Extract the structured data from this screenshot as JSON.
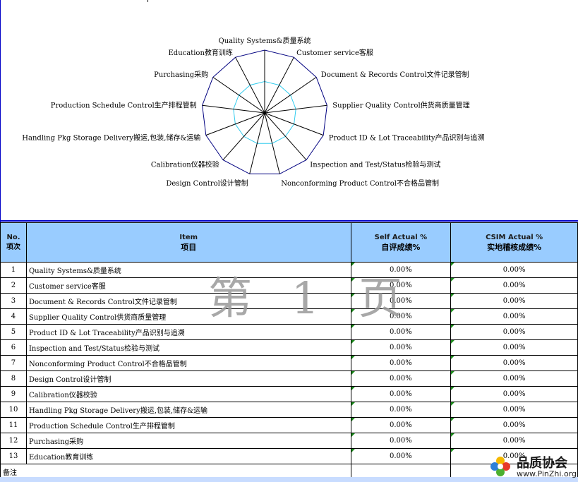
{
  "chart_data": {
    "type": "radar",
    "title": "",
    "categories": [
      "Quality Systems&质量系统",
      "Customer service客服",
      "Document & Records Control文件记录管制",
      "Supplier Quality Control供货商质量管理",
      "Product ID & Lot Traceability产品识别与追溯",
      "Inspection and Test/Status检验与测试",
      "Nonconforming Product Control不合格品管制",
      "Design Control设计管制",
      "Calibration仪器校验",
      "Handling Pkg Storage Delivery搬运,包装,储存&运输",
      "Production Schedule Control生产排程管制",
      "Purchasing采购",
      "Education教育训练"
    ],
    "series": [
      {
        "values": [
          0,
          0,
          0,
          0,
          0,
          0,
          0,
          0,
          0,
          0,
          0,
          0,
          0
        ],
        "color": "#000000"
      },
      {
        "values": [
          0,
          0,
          0,
          0,
          0,
          0,
          0,
          0,
          0,
          0,
          0,
          0,
          0
        ],
        "color": "#000000"
      }
    ],
    "rings": 2,
    "ring_colors": [
      "#33ccee",
      "#000080"
    ],
    "spoke_color": "#000000"
  },
  "table": {
    "headers": {
      "no_en": "No.",
      "no_cn": "项次",
      "item_en": "Item",
      "item_cn": "项目",
      "self_en": "Self Actual %",
      "self_cn": "自评成绩%",
      "csim_en": "CSIM Actual %",
      "csim_cn": "实地稽核成绩%"
    },
    "rows": [
      {
        "no": "1",
        "item": "Quality Systems&质量系统",
        "self": "0.00%",
        "csim": "0.00%"
      },
      {
        "no": "2",
        "item": "Customer service客服",
        "self": "0.00%",
        "csim": "0.00%"
      },
      {
        "no": "3",
        "item": "Document & Records Control文件记录管制",
        "self": "0.00%",
        "csim": "0.00%"
      },
      {
        "no": "4",
        "item": "Supplier Quality Control供货商质量管理",
        "self": "0.00%",
        "csim": "0.00%"
      },
      {
        "no": "5",
        "item": "Product ID & Lot Traceability产品识别与追溯",
        "self": "0.00%",
        "csim": "0.00%"
      },
      {
        "no": "6",
        "item": "Inspection and Test/Status检验与测试",
        "self": "0.00%",
        "csim": "0.00%"
      },
      {
        "no": "7",
        "item": "Nonconforming Product Control不合格品管制",
        "self": "0.00%",
        "csim": "0.00%"
      },
      {
        "no": "8",
        "item": "Design Control设计管制",
        "self": "0.00%",
        "csim": "0.00%"
      },
      {
        "no": "9",
        "item": "Calibration仪器校验",
        "self": "0.00%",
        "csim": "0.00%"
      },
      {
        "no": "10",
        "item": "Handling Pkg Storage Delivery搬运,包装,储存&运输",
        "self": "0.00%",
        "csim": "0.00%"
      },
      {
        "no": "11",
        "item": "Production Schedule  Control生产排程管制",
        "self": "0.00%",
        "csim": "0.00%"
      },
      {
        "no": "12",
        "item": "Purchasing采购",
        "self": "0.00%",
        "csim": "0.00%"
      },
      {
        "no": "13",
        "item": "Education教育训练",
        "self": "0.00%",
        "csim": "0.00%"
      }
    ],
    "remark_label": "备注"
  },
  "watermark": "第 1 页",
  "logo": {
    "name": "品质协会",
    "url": "www.PinZhi.org",
    "icon": "flower-logo-icon"
  }
}
